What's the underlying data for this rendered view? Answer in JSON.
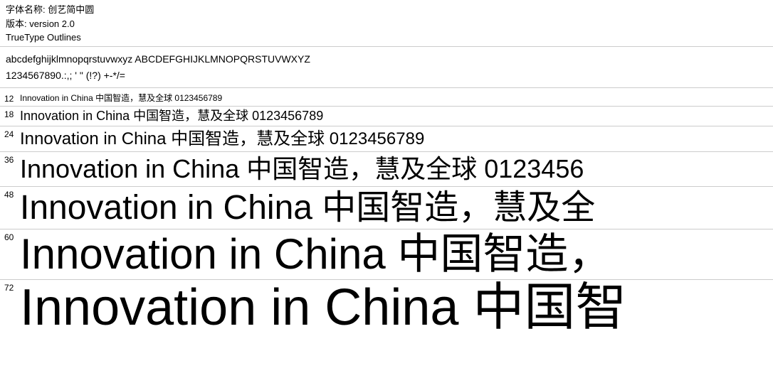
{
  "header": {
    "font_name_label": "字体名称:",
    "font_name_value": "创艺简中圆",
    "version_label": "版本:",
    "version_value": "version 2.0",
    "type_label": "TrueType Outlines"
  },
  "alphabet": {
    "line1": "abcdefghijklmnopqrstuvwxyz ABCDEFGHIJKLMNOPQRSTUVWXYZ",
    "line2": "1234567890.:,; ' \" (!?) +-*/="
  },
  "samples": [
    {
      "size": "12",
      "text": "Innovation in China 中国智造，慧及全球 0123456789"
    },
    {
      "size": "18",
      "text": "Innovation in China 中国智造，慧及全球 0123456789"
    },
    {
      "size": "24",
      "text": "Innovation in China 中国智造，慧及全球 0123456789"
    },
    {
      "size": "36",
      "text": "Innovation in China 中国智造，慧及全球 0123456"
    },
    {
      "size": "48",
      "text": "Innovation in China 中国智造，慧及全"
    },
    {
      "size": "60",
      "text": "Innovation in China 中国智造，"
    },
    {
      "size": "72",
      "text": "Innovation in China 中国智"
    }
  ]
}
